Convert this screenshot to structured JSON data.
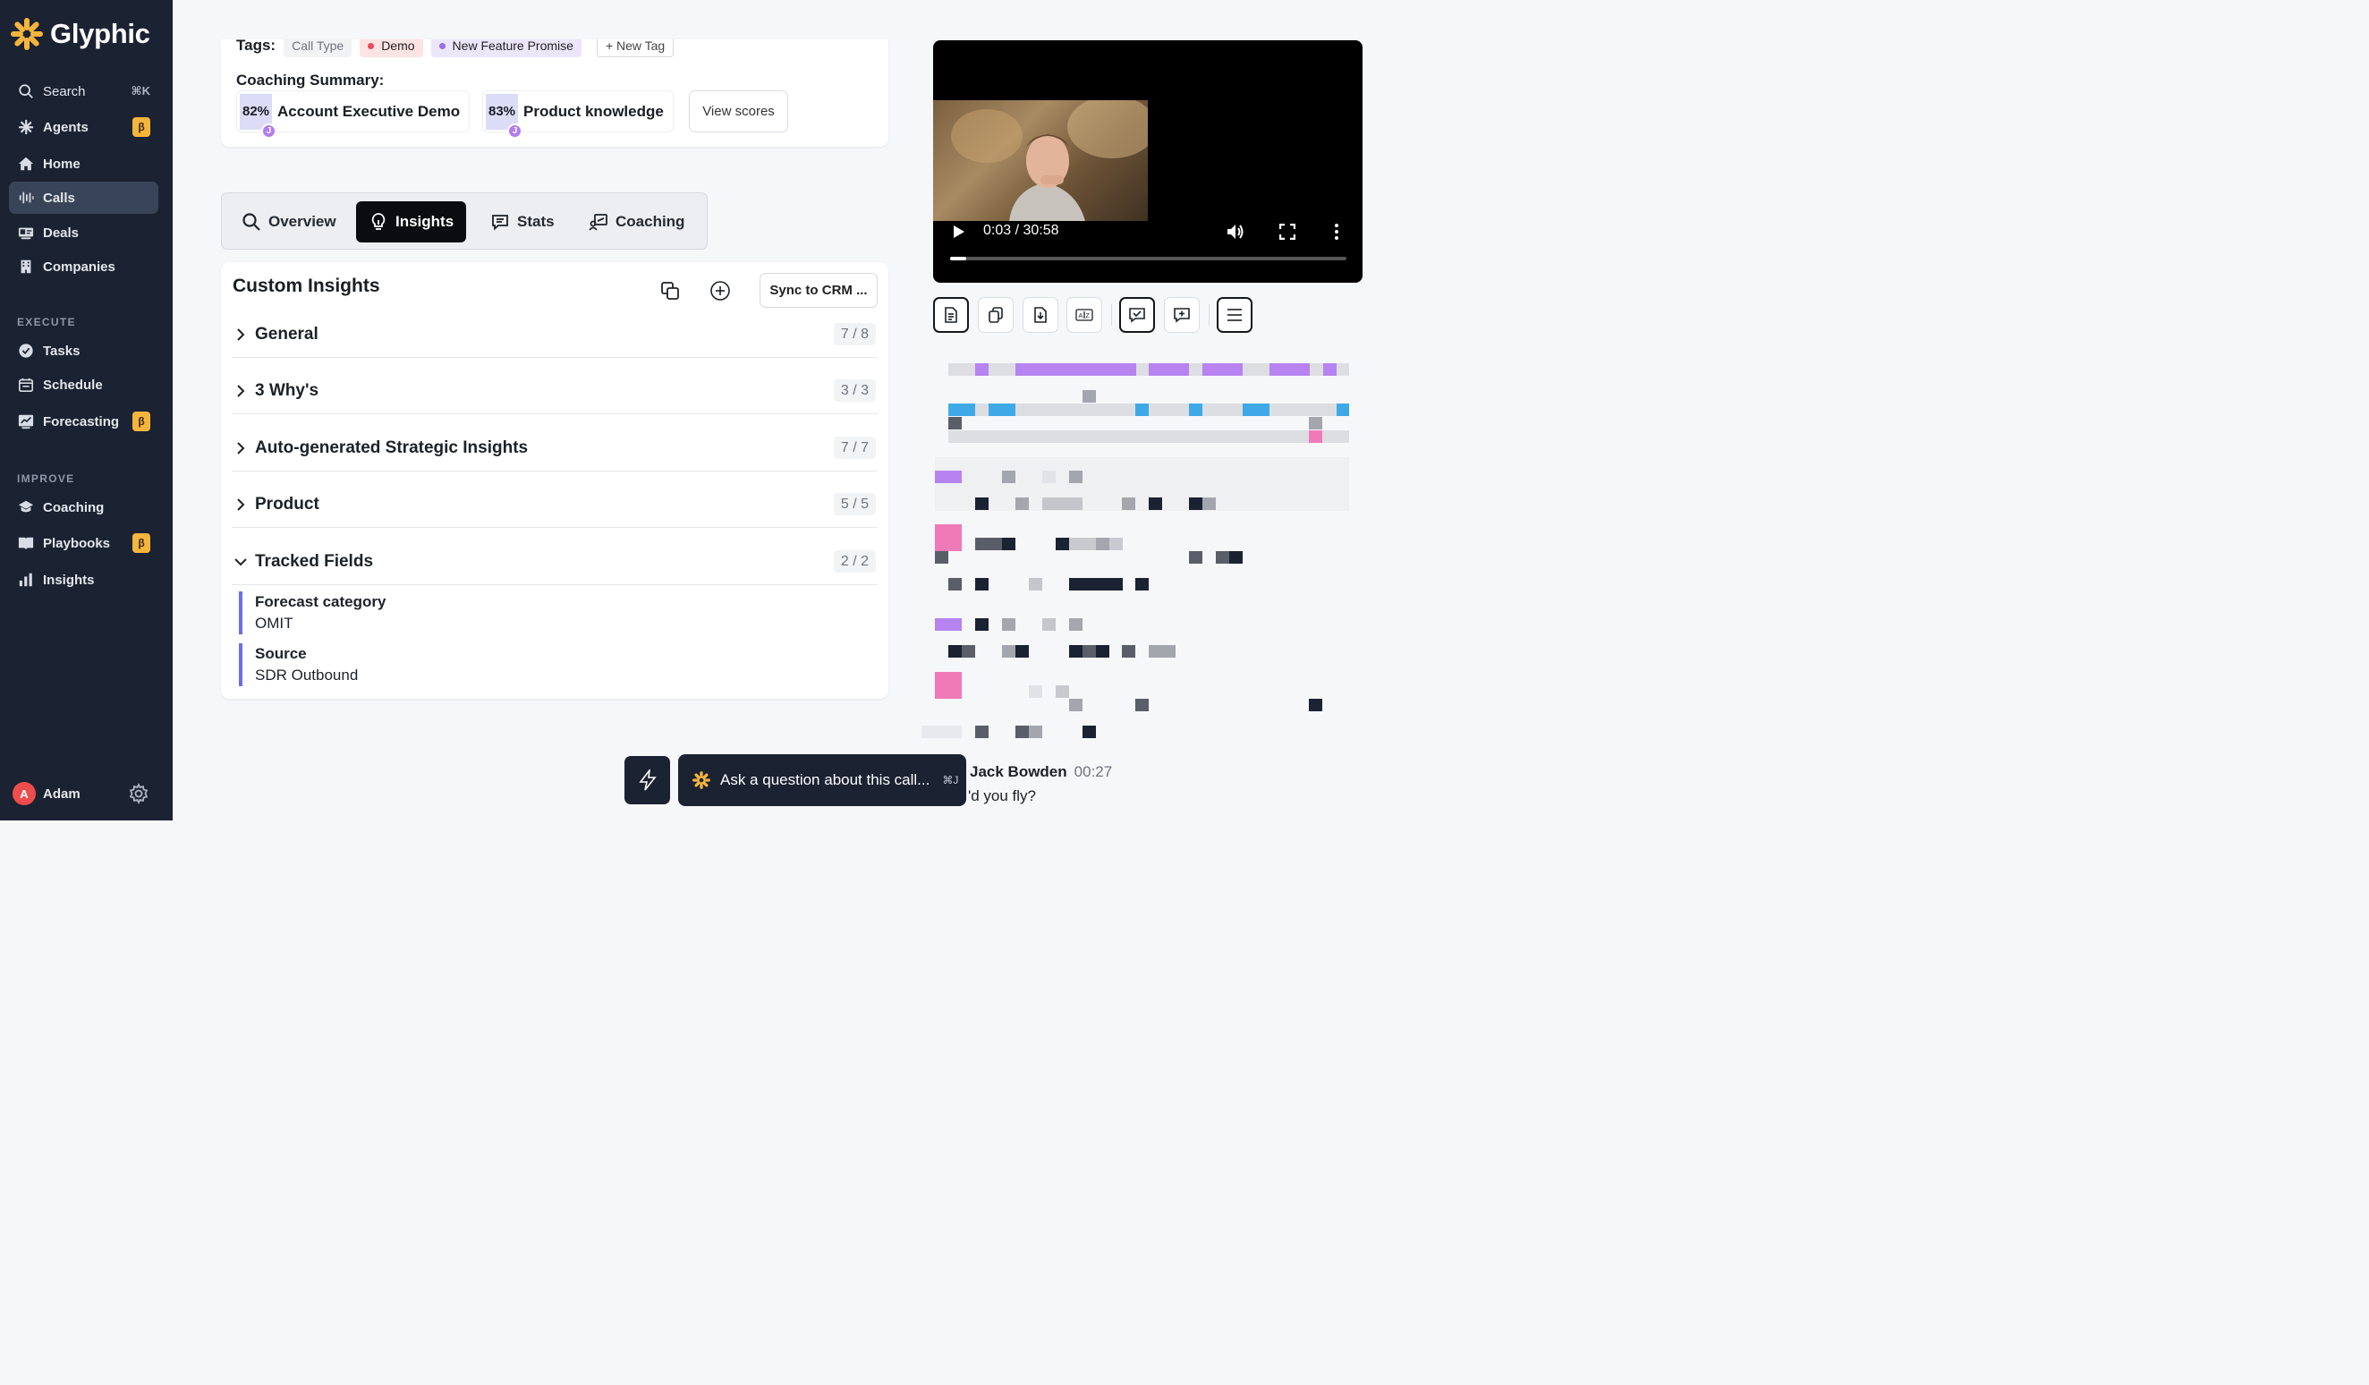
{
  "app": {
    "name": "Glyphic"
  },
  "sidebar": {
    "search": {
      "label": "Search",
      "shortcut": "⌘K"
    },
    "items": [
      {
        "label": "Agents",
        "badge": "β"
      },
      {
        "label": "Home"
      },
      {
        "label": "Calls"
      },
      {
        "label": "Deals"
      },
      {
        "label": "Companies"
      }
    ],
    "execute_label": "EXECUTE",
    "execute_items": [
      {
        "label": "Tasks"
      },
      {
        "label": "Schedule"
      },
      {
        "label": "Forecasting",
        "badge": "β"
      }
    ],
    "improve_label": "IMPROVE",
    "improve_items": [
      {
        "label": "Coaching"
      },
      {
        "label": "Playbooks",
        "badge": "β"
      },
      {
        "label": "Insights"
      }
    ],
    "user": {
      "initial": "A",
      "name": "Adam"
    }
  },
  "summary": {
    "tags_label": "Tags:",
    "tags": [
      "Call Type",
      "Demo",
      "New Feature Promise"
    ],
    "new_tag": "+ New Tag",
    "coaching_label": "Coaching Summary:",
    "scores": [
      {
        "pct": "82%",
        "name": "Account Executive Demo",
        "reviewer": "J"
      },
      {
        "pct": "83%",
        "name": "Product knowledge",
        "reviewer": "J"
      }
    ],
    "view_scores": "View scores"
  },
  "tabs": [
    {
      "label": "Overview"
    },
    {
      "label": "Insights"
    },
    {
      "label": "Stats"
    },
    {
      "label": "Coaching"
    }
  ],
  "insights": {
    "title": "Custom Insights",
    "sync_label": "Sync to CRM ...",
    "rows": [
      {
        "label": "General",
        "count": "7 / 8"
      },
      {
        "label": "3 Why's",
        "count": "3 / 3"
      },
      {
        "label": "Auto-generated Strategic Insights",
        "count": "7 / 7"
      },
      {
        "label": "Product",
        "count": "5 / 5"
      },
      {
        "label": "Tracked Fields",
        "count": "2 / 2"
      }
    ],
    "fields": [
      {
        "name": "Forecast category",
        "value": "OMIT"
      },
      {
        "name": "Source",
        "value": "SDR Outbound"
      }
    ]
  },
  "video": {
    "time": "0:03 / 30:58",
    "progress": 0.04
  },
  "transcript": {
    "speaker": "Jack Bowden",
    "timestamp": "00:27",
    "text": "'d you fly?"
  },
  "ask": {
    "placeholder": "Ask a question about this call...",
    "shortcut": "⌘J"
  },
  "colors": {
    "sidebar": "#1b2232",
    "beta": "#f5b53d",
    "purple": "#b783f0",
    "blue": "#3fa9e8",
    "pink": "#f07ab8",
    "field_border": "#6a6ee8"
  }
}
